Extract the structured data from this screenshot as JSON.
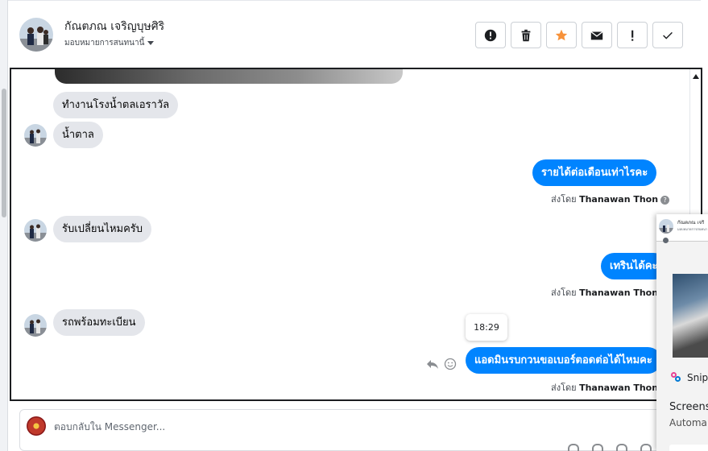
{
  "header": {
    "contact_name": "กัณตภณ เจริญบุษศิริ",
    "assign_label": "มอบหมายการสนทนานี้",
    "actions": [
      {
        "name": "mark-spam-button",
        "icon": "alert-circle-icon"
      },
      {
        "name": "delete-button",
        "icon": "trash-icon"
      },
      {
        "name": "star-button",
        "icon": "star-icon",
        "color": "#f7923a"
      },
      {
        "name": "mail-button",
        "icon": "envelope-icon"
      },
      {
        "name": "follow-up-button",
        "icon": "exclamation-icon"
      },
      {
        "name": "done-button",
        "icon": "check-icon"
      }
    ]
  },
  "messages": {
    "in_1": "ทำงานโรงน้ำตลเอราวัล",
    "in_2": "น้ำตาล",
    "out_1": "รายได้ต่อเดือนเท่าไรคะ",
    "in_3": "รับเปลี่ยนไหมครับ",
    "out_2": "เทรินได้คะ",
    "in_4": "รถพร้อมทะเบียน",
    "out_3": "แอดมินรบกวนขอเบอร์ตอดต่อได้ไหมคะ"
  },
  "sent_by": {
    "prefix": "ส่งโดย",
    "name": "Thanawan Thon"
  },
  "tooltip_time": "18:29",
  "composer": {
    "placeholder": "ตอบกลับใน Messenger..."
  },
  "overlay": {
    "mini_name": "กัณตภณ เจริ",
    "mini_sub": "มอบหมายการสนทนา",
    "snip_label": "Snip",
    "title": "Screens",
    "subtitle": "Automa"
  },
  "colors": {
    "accent": "#0084ff",
    "incoming_bubble": "#e4e6eb",
    "star": "#f7923a"
  }
}
